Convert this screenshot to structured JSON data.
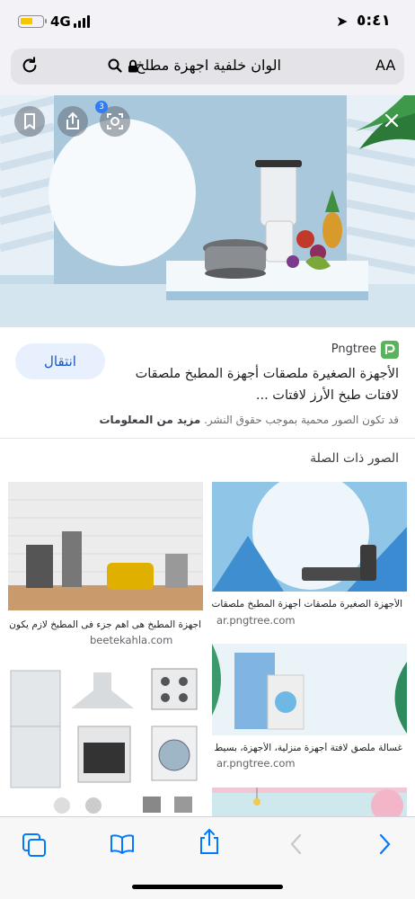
{
  "status": {
    "network": "4G",
    "time": "٥:٤١"
  },
  "browser": {
    "url_text": "الوان خلفية اجهزة مطلخ",
    "aa_label": "AA"
  },
  "hero": {
    "badge_count": "3"
  },
  "result": {
    "visit_label": "انتقال",
    "site_name": "Pngtree",
    "title": "الأجهزة الصغيرة ملصقات أجهزة المطبخ ملصقات لافتات طبخ الأرز لافتات ...",
    "copyright_text": "قد تكون الصور محمية بموجب حقوق النشر.",
    "more_info": "مزيد من المعلومات"
  },
  "related": {
    "title": "الصور ذات الصلة",
    "items": [
      {
        "caption": "الأجهزة الصغيرة ملصقات أجهزة المطبخ ملصقات لا...",
        "source": "ar.pngtree.com"
      },
      {
        "caption": "اجهزة المطبخ هى اهم جزء فى المطبخ لازم يكون ترة ...",
        "source": "beetekahla.com"
      },
      {
        "caption": "غسالة ملصق لافتة أجهزة منزلية، الأجهزة، بسيط ا...",
        "source": "ar.pngtree.com"
      }
    ]
  },
  "icons": [
    "reload-icon",
    "search-icon",
    "lock-icon",
    "bookmark-icon",
    "share-icon",
    "visual-lookup-icon",
    "close-icon",
    "tabs-icon",
    "bookmarks-book-icon",
    "share-icon",
    "back-chevron-icon",
    "forward-chevron-icon"
  ]
}
